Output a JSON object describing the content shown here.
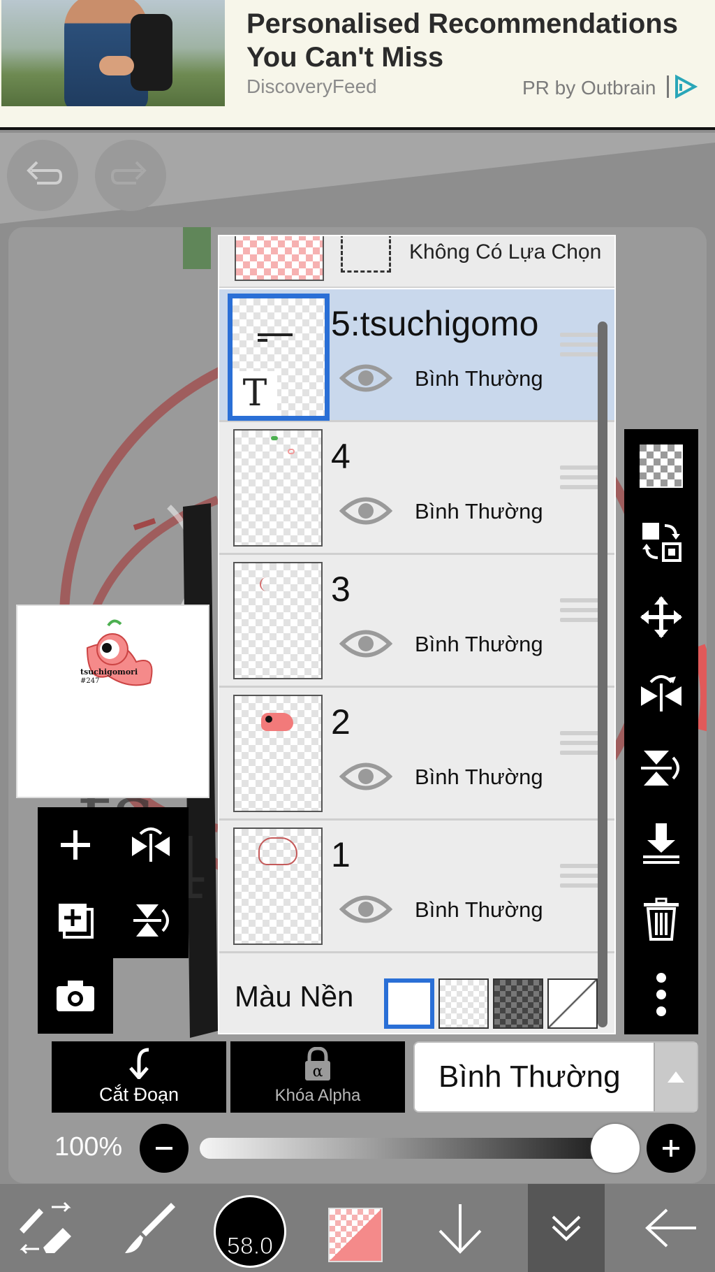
{
  "ad": {
    "title": "Personalised Recommendations You Can't Miss",
    "source": "DiscoveryFeed",
    "sponsor": "PR by Outbrain"
  },
  "layers_panel": {
    "selection_label": "Không Có Lựa Chọn",
    "layers": [
      {
        "name": "5:tsuchigomo",
        "mode": "Bình Thường",
        "active": true,
        "type": "text"
      },
      {
        "name": "4",
        "mode": "Bình Thường",
        "active": false
      },
      {
        "name": "3",
        "mode": "Bình Thường",
        "active": false
      },
      {
        "name": "2",
        "mode": "Bình Thường",
        "active": false
      },
      {
        "name": "1",
        "mode": "Bình Thường",
        "active": false
      }
    ],
    "background_label": "Màu Nền",
    "text_layer_marker": "T"
  },
  "preview": {
    "text_line1": "tsuchigomori",
    "text_line2": "#247"
  },
  "controls": {
    "clip_label": "Cắt Đoạn",
    "alpha_lock_label": "Khóa Alpha",
    "blend_mode": "Bình Thường",
    "opacity_text": "100%",
    "opacity_value": 1.0
  },
  "bottombar": {
    "brush_size": "58.0"
  },
  "colors": {
    "accent": "#2a6fd6",
    "active_row": "#c9d8ec",
    "current_color": "#f48a8a"
  }
}
